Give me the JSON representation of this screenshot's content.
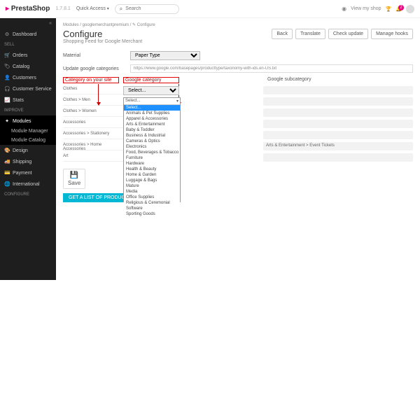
{
  "brand": {
    "name": "PrestaShop",
    "version": "1.7.8.1"
  },
  "topbar": {
    "quick_access": "Quick Access",
    "search_placeholder": "Search",
    "view_shop": "View my shop",
    "notif_count": "2"
  },
  "sidebar": {
    "collapse": "«",
    "dashboard": "Dashboard",
    "head_sell": "SELL",
    "orders": "Orders",
    "catalog": "Catalog",
    "customers": "Customers",
    "customer_service": "Customer Service",
    "stats": "Stats",
    "head_improve": "IMPROVE",
    "modules": "Modules",
    "module_manager": "Module Manager",
    "module_catalog": "Module Catalog",
    "design": "Design",
    "shipping": "Shipping",
    "payment": "Payment",
    "international": "International",
    "head_configure": "CONFIGURE"
  },
  "breadcrumb": "Modules  /  googlemerchantpremium  /  ✎ Configure",
  "page": {
    "title": "Configure",
    "subtitle": "Shopping Feed for Google Merchant"
  },
  "buttons": {
    "back": "Back",
    "translate": "Translate",
    "check": "Check update",
    "manage": "Manage hooks"
  },
  "form": {
    "material": "Material",
    "paper_type": "Paper Type",
    "update_lbl": "Update google categories",
    "url": "https://www.google.com/basepages/producttype/taxonomy-with-ids.en-US.txt",
    "col1": "Category on your site",
    "col2": "Google category",
    "col3": "Google subcategory",
    "select": "Select...",
    "save": "Save",
    "get": "GET A LIST OF PRODUCTS"
  },
  "categories": [
    "Clothes",
    "Clothes > Men",
    "Clothes > Women",
    "Accessories",
    "Accessories > Stationery",
    "Accessories > Home Accessories",
    "Art"
  ],
  "sub_example": "Arts & Entertainment > Event Tickets",
  "google_cats": [
    "Select...",
    "Animals & Pet Supplies",
    "Apparel & Accessories",
    "Arts & Entertainment",
    "Baby & Toddler",
    "Business & Industrial",
    "Cameras & Optics",
    "Electronics",
    "Food, Beverages & Tobacco",
    "Furniture",
    "Hardware",
    "Health & Beauty",
    "Home & Garden",
    "Luggage & Bags",
    "Mature",
    "Media",
    "Office Supplies",
    "Religious & Ceremonial",
    "Software",
    "Sporting Goods"
  ]
}
